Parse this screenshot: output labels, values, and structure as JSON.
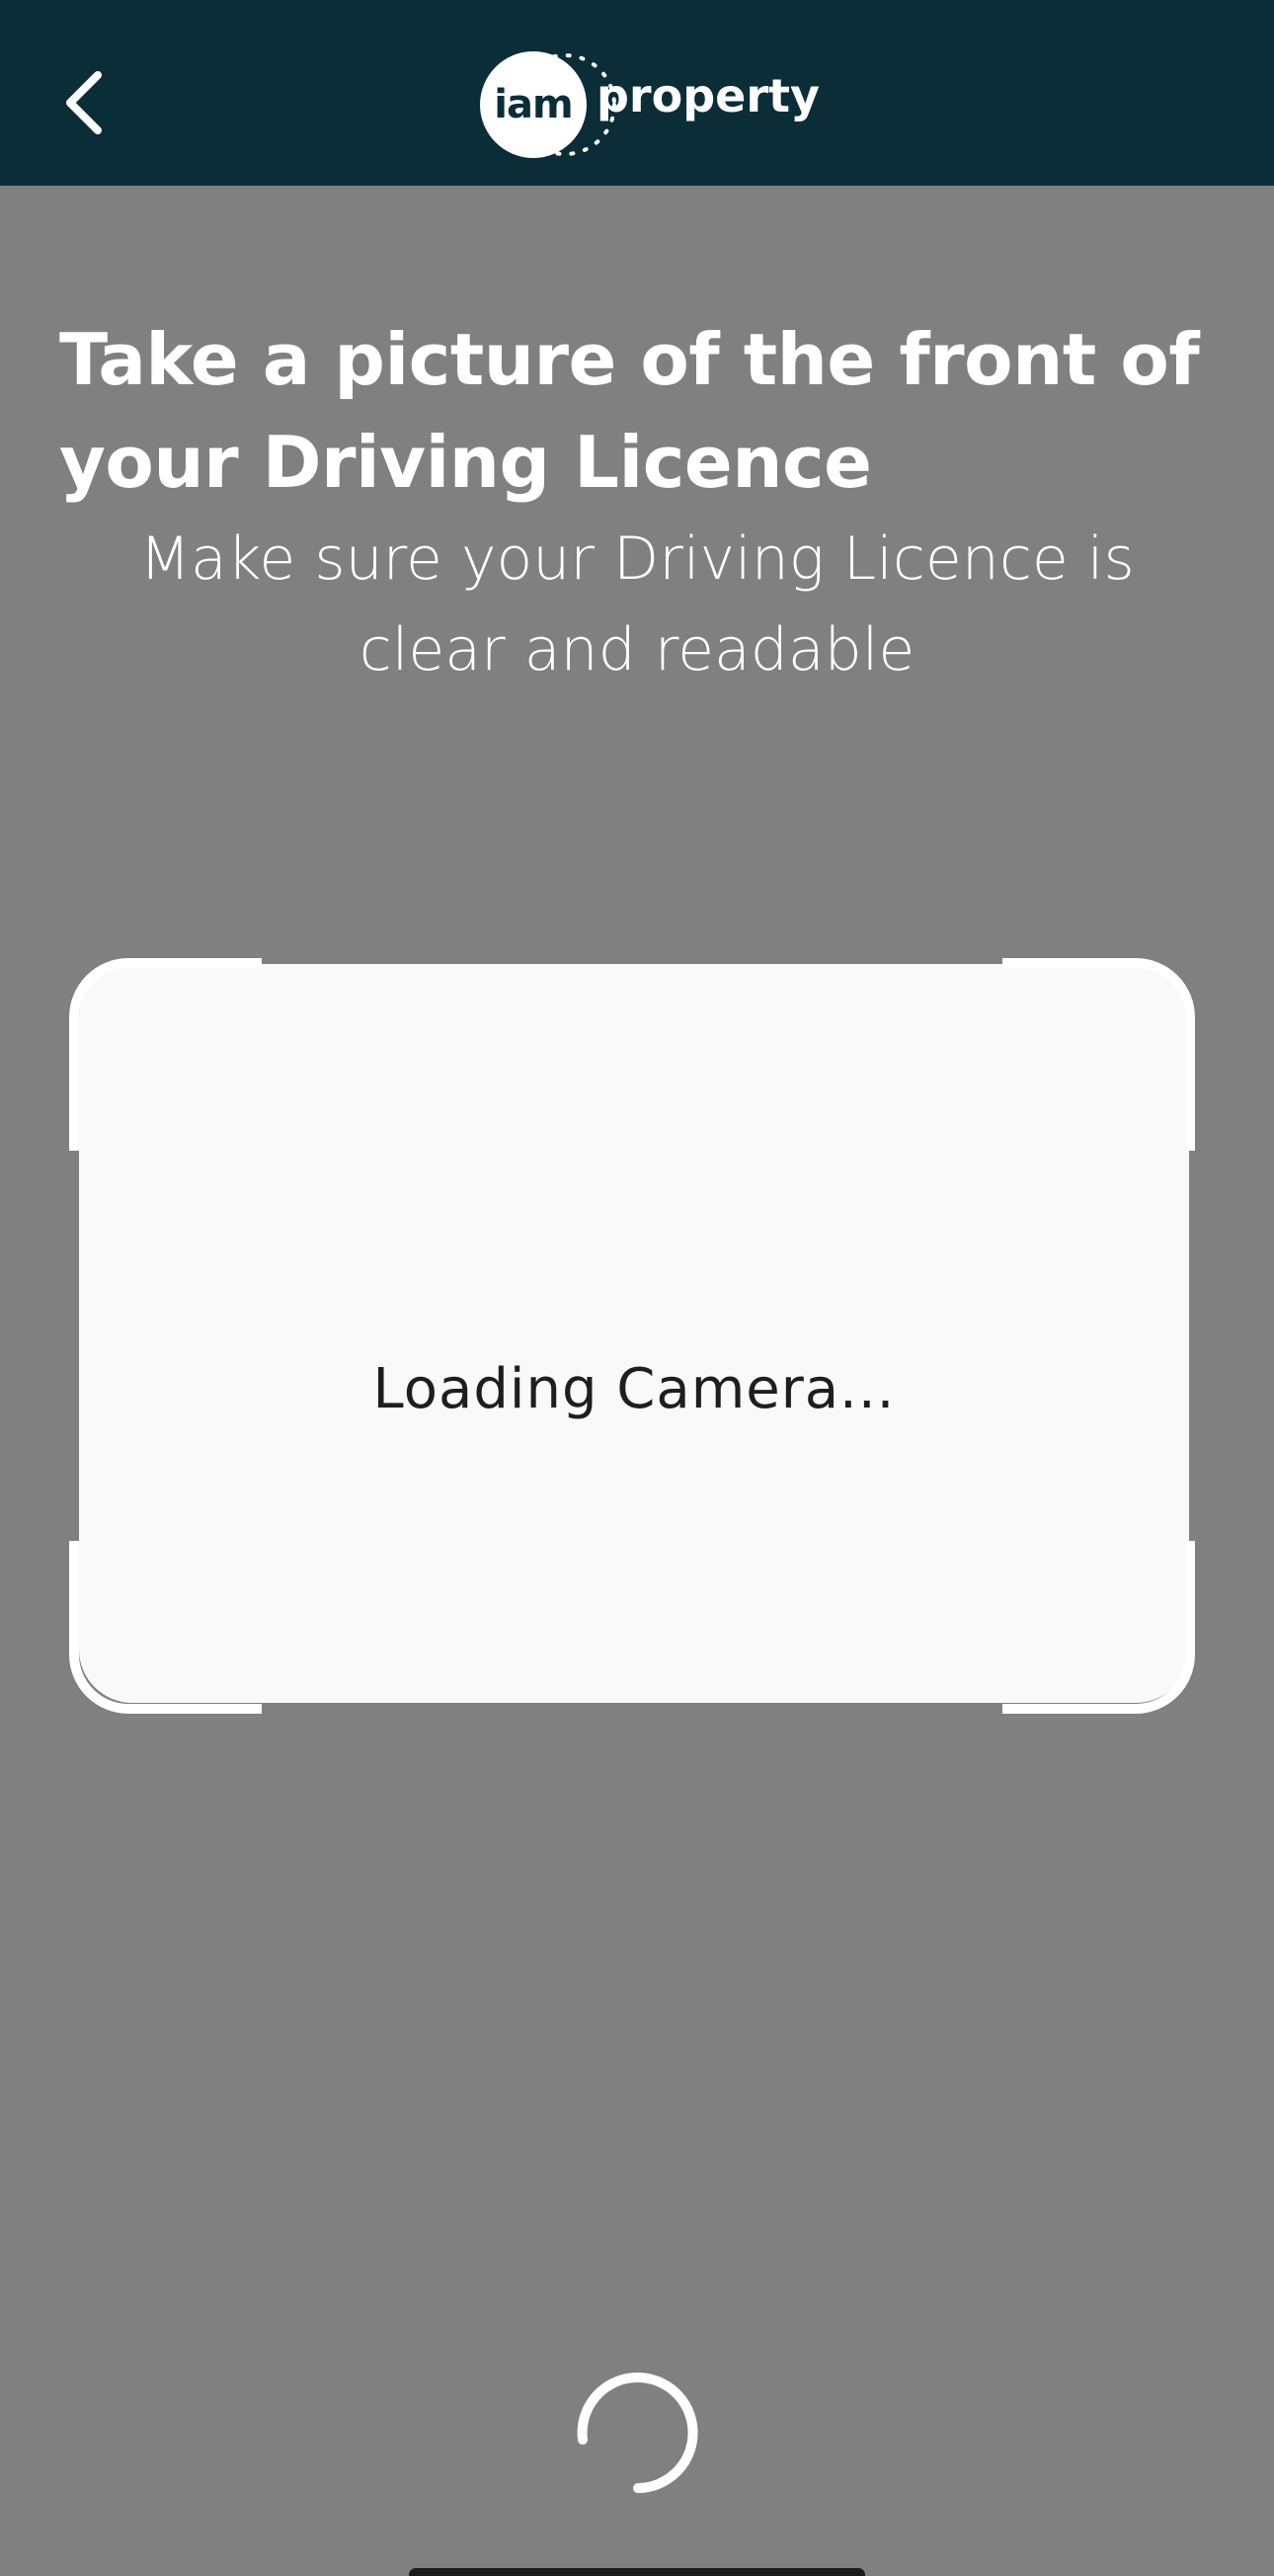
{
  "header": {
    "logo_circle_text": "iam",
    "logo_word": "property",
    "background_color": "#0b2d38"
  },
  "icons": {
    "back": "chevron-left-icon",
    "loading": "spinner-icon"
  },
  "content": {
    "title": "Take a picture of the front of your Driving Licence",
    "subtitle": "Make sure your Driving Licence is clear and readable",
    "camera_status": "Loading Camera..."
  },
  "colors": {
    "page_background": "#808080",
    "camera_box": "#f9f9f9",
    "text_light": "#ffffff",
    "text_dark": "#1e1e1e"
  }
}
